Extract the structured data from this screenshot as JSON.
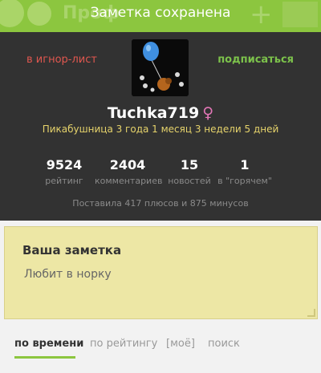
{
  "toast": {
    "text": "Заметка сохранена"
  },
  "header": {
    "title_ghost": "Проф",
    "plus_glyph": "+"
  },
  "profile": {
    "ignore_label": "в игнор-лист",
    "subscribe_label": "подписаться",
    "username": "Tuchka719",
    "gender_glyph": "♀",
    "tenure": "Пикабушница 3 года 1 месяц 3 недели 5 дней",
    "stats": [
      {
        "value": "9524",
        "label": "рейтинг"
      },
      {
        "value": "2404",
        "label": "комментариев"
      },
      {
        "value": "15",
        "label": "новостей"
      },
      {
        "value": "1",
        "label": "в \"горячем\""
      }
    ],
    "votes": "Поставила 417 плюсов и 875 минусов"
  },
  "note": {
    "title": "Ваша заметка",
    "text": "Любит в норку"
  },
  "tabs": [
    {
      "label": "по времени"
    },
    {
      "label": "по рейтингу"
    },
    {
      "label": "[моё]"
    },
    {
      "label": "поиск"
    }
  ],
  "colors": {
    "brand_green": "#8cc63f",
    "dark_panel": "#323232",
    "ignore_red": "#e0574f",
    "subscribe_green": "#7cc24b",
    "tenure_yellow": "#e6d36b",
    "note_bg": "#ede7a5"
  }
}
